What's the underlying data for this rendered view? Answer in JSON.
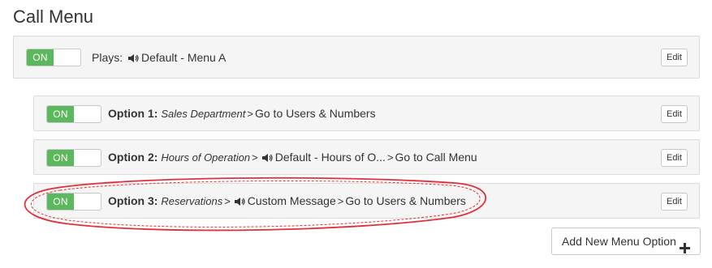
{
  "page": {
    "title": "Call Menu"
  },
  "main_menu": {
    "toggle_label": "ON",
    "plays_label": "Plays:",
    "audio_name": "Default - Menu A",
    "edit_label": "Edit"
  },
  "options": [
    {
      "toggle_label": "ON",
      "option_label": "Option 1:",
      "name": "Sales Department",
      "separator": ">",
      "action": "Go to Users & Numbers",
      "edit_label": "Edit"
    },
    {
      "toggle_label": "ON",
      "option_label": "Option 2:",
      "name": "Hours of Operation",
      "separator": ">",
      "audio_name": "Default - Hours of O...",
      "action": "Go to Call Menu",
      "edit_label": "Edit"
    },
    {
      "toggle_label": "ON",
      "option_label": "Option 3:",
      "name": "Reservations",
      "separator": ">",
      "audio_name": "Custom Message",
      "action": "Go to Users & Numbers",
      "edit_label": "Edit"
    }
  ],
  "add_button": {
    "label": "Add New Menu Option"
  },
  "icons": {
    "speaker": "speaker-icon",
    "plus": "plus-icon"
  },
  "colors": {
    "toggle_on": "#5cb85c",
    "panel_bg": "#f5f5f5",
    "annotation": "#e0303a"
  }
}
